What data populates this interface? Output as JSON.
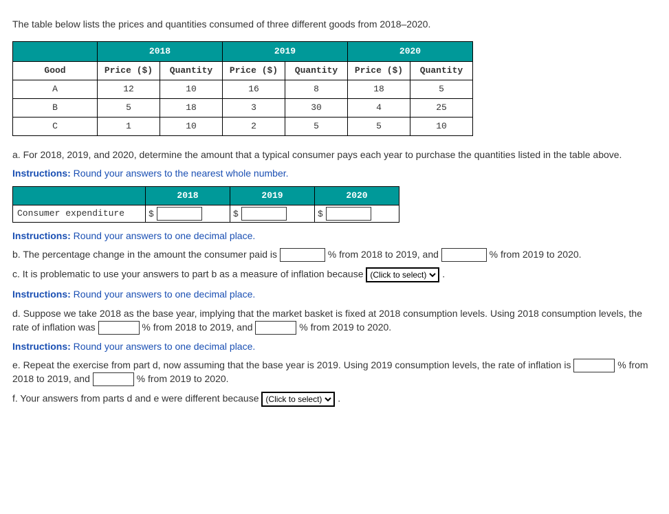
{
  "intro": "The table below lists the prices and quantities consumed of three different goods from 2018–2020.",
  "table": {
    "years": [
      "2018",
      "2019",
      "2020"
    ],
    "head": {
      "good": "Good",
      "price": "Price ($)",
      "qty": "Quantity"
    },
    "rows": [
      {
        "good": "A",
        "p18": "12",
        "q18": "10",
        "p19": "16",
        "q19": "8",
        "p20": "18",
        "q20": "5"
      },
      {
        "good": "B",
        "p18": "5",
        "q18": "18",
        "p19": "3",
        "q19": "30",
        "p20": "4",
        "q20": "25"
      },
      {
        "good": "C",
        "p18": "1",
        "q18": "10",
        "p19": "2",
        "q19": "5",
        "p20": "5",
        "q20": "10"
      }
    ]
  },
  "a_text": "a. For 2018, 2019, and 2020, determine the amount that a typical consumer pays each year to purchase the quantities listed in the table above.",
  "instr_whole": {
    "label": "Instructions:",
    "text": " Round your answers to the nearest whole number."
  },
  "expend": {
    "label": "Consumer expenditure",
    "dollar": "$",
    "years": [
      "2018",
      "2019",
      "2020"
    ]
  },
  "instr_dec": {
    "label": "Instructions:",
    "text": " Round your answers to one decimal place."
  },
  "b": {
    "pre": "b. The percentage change in the amount the consumer paid is ",
    "mid": " % from 2018 to 2019, and ",
    "post": " % from 2019 to 2020."
  },
  "c": {
    "pre": "c. It is problematic to use your answers to part b as a measure of inflation because ",
    "sel": "(Click to select)",
    "post": " ."
  },
  "d": {
    "pre": "d. Suppose we take 2018 as the base year, implying that the market basket is fixed at 2018 consumption levels. Using 2018 consumption levels, the rate of inflation was ",
    "mid": " % from 2018 to 2019, and ",
    "post": " % from 2019 to 2020."
  },
  "e": {
    "pre": "e. Repeat the exercise from part d, now assuming that the base year is 2019. Using 2019 consumption levels, the rate of inflation is ",
    "mid": " % from 2018 to 2019, and ",
    "post": " % from 2019 to 2020."
  },
  "f": {
    "pre": "f. Your answers from parts d and e were different because ",
    "sel": "(Click to select)",
    "post": " ."
  }
}
